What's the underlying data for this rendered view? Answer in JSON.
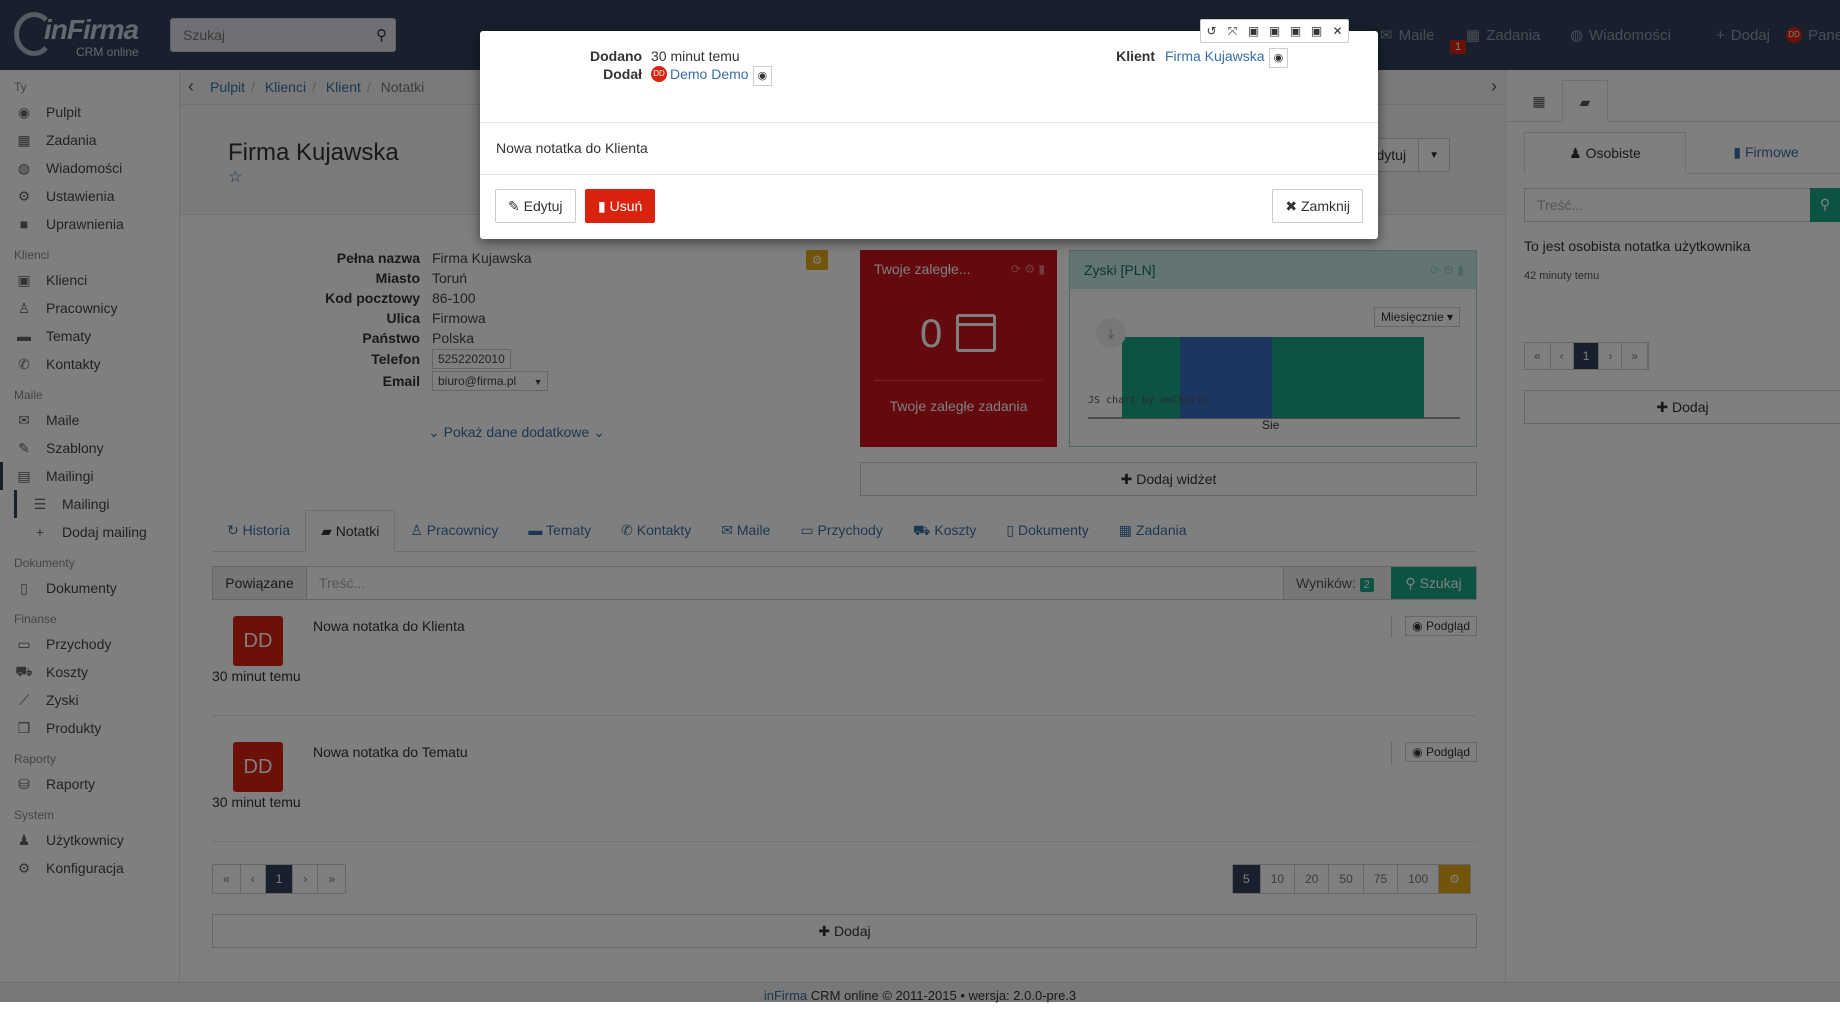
{
  "topbar": {
    "logo_text": "inFirma",
    "logo_sub": "CRM online",
    "search_placeholder": "Szukaj",
    "nav": [
      {
        "icon": "envelope-icon",
        "label": "Maile"
      },
      {
        "icon": "calendar-icon",
        "label": "Zadania"
      },
      {
        "icon": "comments-icon",
        "label": "Wiadomości"
      },
      {
        "icon": "plus-icon",
        "label": "Dodaj"
      },
      {
        "icon": "dd-avatar",
        "label": "Pane"
      }
    ],
    "tasks_badge": "1"
  },
  "sidebar": {
    "sections": [
      {
        "title": "Ty",
        "items": [
          {
            "label": "Pulpit",
            "icon": "dashboard-icon",
            "glyph": "◉"
          },
          {
            "label": "Zadania",
            "icon": "calendar-icon",
            "glyph": "▦"
          },
          {
            "label": "Wiadomości",
            "icon": "comments-icon",
            "glyph": "◍"
          },
          {
            "label": "Ustawienia",
            "icon": "gear-icon",
            "glyph": "⚙"
          },
          {
            "label": "Uprawnienia",
            "icon": "lock-icon",
            "glyph": "■"
          }
        ]
      },
      {
        "title": "Klienci",
        "items": [
          {
            "label": "Klienci",
            "icon": "building-icon",
            "glyph": "▣"
          },
          {
            "label": "Pracownicy",
            "icon": "male-icon",
            "glyph": "♙"
          },
          {
            "label": "Tematy",
            "icon": "folder-icon",
            "glyph": "▬"
          },
          {
            "label": "Kontakty",
            "icon": "phone-icon",
            "glyph": "✆"
          }
        ]
      },
      {
        "title": "Maile",
        "items": [
          {
            "label": "Maile",
            "icon": "envelope-icon",
            "glyph": "✉"
          },
          {
            "label": "Szablony",
            "icon": "wrench-icon",
            "glyph": "✎"
          },
          {
            "label": "Mailingi",
            "icon": "newspaper-icon",
            "glyph": "▤",
            "active": true
          },
          {
            "label": "Mailingi",
            "icon": "list-icon",
            "glyph": "☰",
            "sub": true,
            "current": true
          },
          {
            "label": "Dodaj mailing",
            "icon": "plus-icon",
            "glyph": "+",
            "sub": true
          }
        ]
      },
      {
        "title": "Dokumenty",
        "items": [
          {
            "label": "Dokumenty",
            "icon": "file-icon",
            "glyph": "▯"
          }
        ]
      },
      {
        "title": "Finanse",
        "items": [
          {
            "label": "Przychody",
            "icon": "money-icon",
            "glyph": "▭"
          },
          {
            "label": "Koszty",
            "icon": "cart-icon",
            "glyph": "⛟"
          },
          {
            "label": "Zyski",
            "icon": "chart-line-icon",
            "glyph": "⟋"
          },
          {
            "label": "Produkty",
            "icon": "cube-icon",
            "glyph": "❒"
          }
        ]
      },
      {
        "title": "Raporty",
        "items": [
          {
            "label": "Raporty",
            "icon": "database-icon",
            "glyph": "⛁"
          }
        ]
      },
      {
        "title": "System",
        "items": [
          {
            "label": "Użytkownicy",
            "icon": "user-icon",
            "glyph": "♟"
          },
          {
            "label": "Konfiguracja",
            "icon": "cogs-icon",
            "glyph": "⚙"
          }
        ]
      }
    ]
  },
  "breadcrumb": [
    "Pulpit",
    "Klienci",
    "Klient",
    "Notatki"
  ],
  "page": {
    "title": "Firma Kujawska",
    "edit_label": "Edytuj"
  },
  "client_info": [
    {
      "label": "Pełna nazwa",
      "value": "Firma Kujawska"
    },
    {
      "label": "Miasto",
      "value": "Toruń"
    },
    {
      "label": "Kod pocztowy",
      "value": "86-100"
    },
    {
      "label": "Ulica",
      "value": "Firmowa"
    },
    {
      "label": "Państwo",
      "value": "Polska"
    },
    {
      "label": "Telefon",
      "value": "5252202010",
      "boxed": true
    },
    {
      "label": "Email",
      "value": "biuro@firma.pl",
      "boxed": true
    }
  ],
  "more_info": "Pokaż dane dodatkowe",
  "widget_tasks": {
    "title": "Twoje zaległe...",
    "count": "0",
    "footer": "Twoje zaległe zadania"
  },
  "widget_profit": {
    "title": "Zyski [PLN]",
    "period": "Miesięcznie",
    "credit": "JS chart by amCharts",
    "x_label": "Sie"
  },
  "add_widget": "Dodaj widżet",
  "tabs": [
    "Historia",
    "Notatki",
    "Pracownicy",
    "Tematy",
    "Kontakty",
    "Maile",
    "Przychody",
    "Koszty",
    "Dokumenty",
    "Zadania"
  ],
  "filter": {
    "related": "Powiązane",
    "placeholder": "Treść...",
    "results_label": "Wyników:",
    "results_count": "2",
    "search_btn": "Szukaj"
  },
  "notes": [
    {
      "avatar": "DD",
      "text": "Nowa notatka do Klienta",
      "time": "30 minut temu",
      "preview": "Podgląd"
    },
    {
      "avatar": "DD",
      "text": "Nowa notatka do Tematu",
      "time": "30 minut temu",
      "preview": "Podgląd"
    }
  ],
  "pagination": [
    "«",
    "‹",
    "1",
    "›",
    "»"
  ],
  "page_sizes": [
    "5",
    "10",
    "20",
    "50",
    "75",
    "100"
  ],
  "add_label": "Dodaj",
  "right_panel": {
    "tab_personal": "Osobiste",
    "tab_company": "Firmowe",
    "search_placeholder": "Treść...",
    "note_text": "To jest osobista notatka użytkownika",
    "note_time": "42 minuty temu",
    "pagination": [
      "«",
      "‹",
      "1",
      "›",
      "»"
    ],
    "add_label": "Dodaj"
  },
  "footer": {
    "brand": "inFirma",
    "text": "CRM online © 2011-2015 • wersja: 2.0.0-pre.3"
  },
  "modal": {
    "added_label": "Dodano",
    "added_value": "30 minut temu",
    "by_label": "Dodał",
    "by_avatar": "DD",
    "by_value": "Demo Demo",
    "client_label": "Klient",
    "client_value": "Firma Kujawska",
    "body": "Nowa notatka do Klienta",
    "edit_btn": "Edytuj",
    "delete_btn": "Usuń",
    "close_btn": "Zamknij"
  },
  "chart_data": {
    "type": "bar",
    "categories": [
      "Sie"
    ],
    "series": [
      {
        "values": [
          1
        ],
        "color": "#18a689"
      },
      {
        "values": [
          1
        ],
        "color": "#3b6dbf"
      },
      {
        "values": [
          1
        ],
        "color": "#18a689"
      }
    ],
    "colors": {
      "teal": "#18a689",
      "blue": "#3b6dbf"
    }
  },
  "colors": {
    "topbar": "#2f4159",
    "accent_teal": "#18a689",
    "danger": "#d9230f",
    "link": "#3a6ea5",
    "gold": "#e6a817"
  }
}
